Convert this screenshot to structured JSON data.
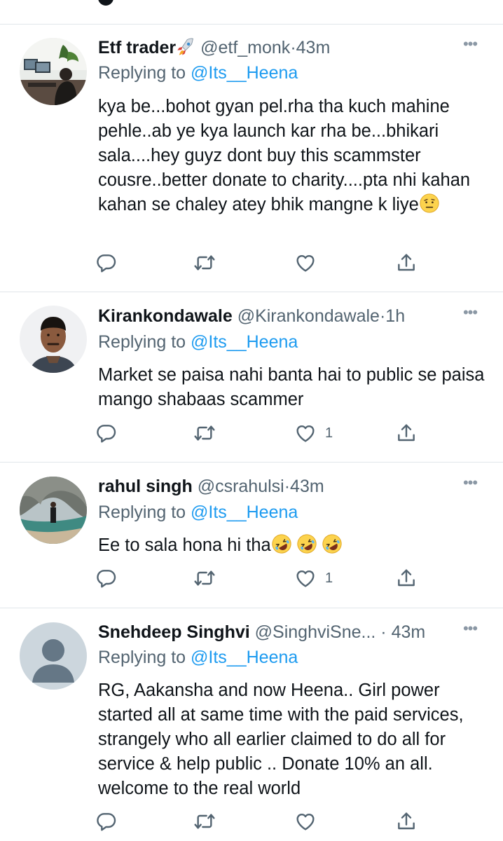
{
  "replies": [
    {
      "name": "Etf trader",
      "name_emoji": "rocket",
      "handle": "@etf_monk",
      "time": "43m",
      "replying_prefix": "Replying to",
      "replying_to": "@Its__Heena",
      "text": "kya be...bohot gyan pel.rha tha kuch mahine pehle..ab ye kya launch kar rha be...bhikari sala....hey guyz dont buy this scammster cousre..better donate to charity....pta nhi kahan kahan se chaley atey bhik mangne k liye",
      "text_emoji": "face-with-raised-eyebrow",
      "likes": ""
    },
    {
      "name": "Kirankondawale",
      "handle": "@Kirankondawale",
      "time": "1h",
      "replying_prefix": "Replying to",
      "replying_to": "@Its__Heena",
      "text": "Market se paisa nahi banta hai to public se paisa mango shabaas scammer",
      "likes": "1"
    },
    {
      "name": "rahul singh",
      "handle": "@csrahulsi",
      "time": "43m",
      "replying_prefix": "Replying to",
      "replying_to": "@Its__Heena",
      "text": "Ee to sala hona hi tha",
      "text_emoji": "rolling-on-floor-laughing x3",
      "likes": "1"
    },
    {
      "name": "Snehdeep Singhvi",
      "handle": "@SinghviSne...",
      "time": "43m",
      "replying_prefix": "Replying to",
      "replying_to": "@Its__Heena",
      "text": "RG, Aakansha and now Heena.. Girl power started all at same time with the paid services, strangely who all earlier claimed to do all for service & help public .. Donate 10% an all. welcome to the real world",
      "likes": ""
    }
  ],
  "icons": {
    "reply": "reply-icon",
    "retweet": "retweet-icon",
    "like": "like-icon",
    "share": "share-icon",
    "more": "more-options-icon"
  },
  "colors": {
    "mention": "#1d9bf0",
    "secondary": "#536471",
    "divider": "#e1e6ea"
  }
}
